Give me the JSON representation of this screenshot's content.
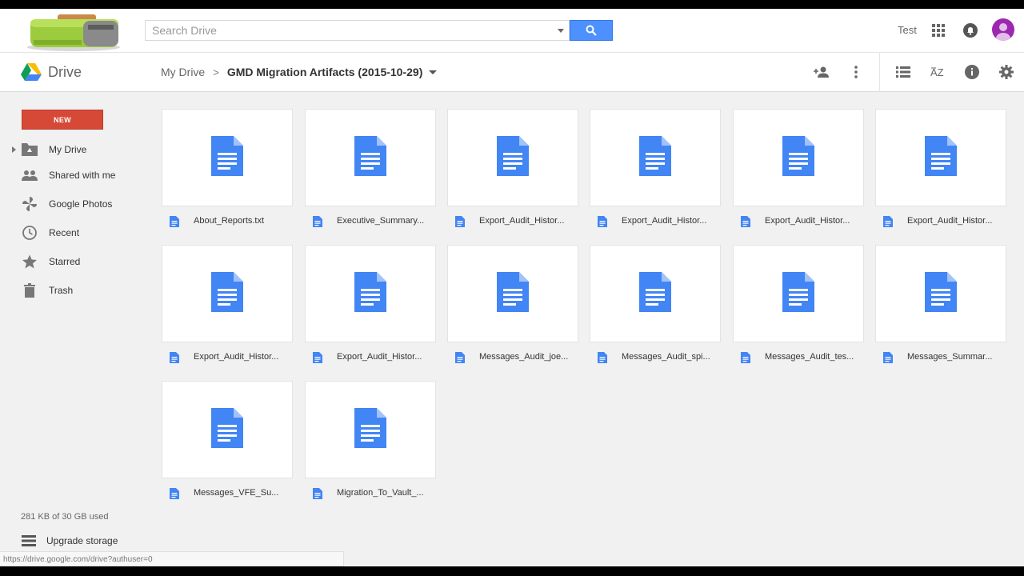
{
  "header": {
    "search_placeholder": "Search Drive",
    "user_name": "Test"
  },
  "subheader": {
    "brand": "Drive",
    "breadcrumb_root": "My Drive",
    "breadcrumb_separator": ">",
    "breadcrumb_current": "GMD Migration Artifacts (2015-10-29)"
  },
  "sidebar": {
    "new_label": "NEW",
    "items": [
      {
        "label": "My Drive",
        "icon": "folder-drive-icon"
      },
      {
        "label": "Shared with me",
        "icon": "people-icon"
      },
      {
        "label": "Google Photos",
        "icon": "pinwheel-icon"
      },
      {
        "label": "Recent",
        "icon": "clock-icon"
      },
      {
        "label": "Starred",
        "icon": "star-icon"
      },
      {
        "label": "Trash",
        "icon": "trash-icon"
      }
    ],
    "storage": "281 KB of 30 GB used",
    "upgrade_label": "Upgrade storage"
  },
  "status_url": "https://drive.google.com/drive?authuser=0",
  "files": [
    {
      "name": "About_Reports.txt"
    },
    {
      "name": "Executive_Summary..."
    },
    {
      "name": "Export_Audit_Histor..."
    },
    {
      "name": "Export_Audit_Histor..."
    },
    {
      "name": "Export_Audit_Histor..."
    },
    {
      "name": "Export_Audit_Histor..."
    },
    {
      "name": "Export_Audit_Histor..."
    },
    {
      "name": "Export_Audit_Histor..."
    },
    {
      "name": "Messages_Audit_joe..."
    },
    {
      "name": "Messages_Audit_spi..."
    },
    {
      "name": "Messages_Audit_tes..."
    },
    {
      "name": "Messages_Summar..."
    },
    {
      "name": "Messages_VFE_Su..."
    },
    {
      "name": "Migration_To_Vault_..."
    }
  ],
  "colors": {
    "accent_blue": "#4d90fe",
    "doc_blue": "#4285f4",
    "new_red": "#d64937",
    "avatar_purple": "#9c27b0"
  }
}
